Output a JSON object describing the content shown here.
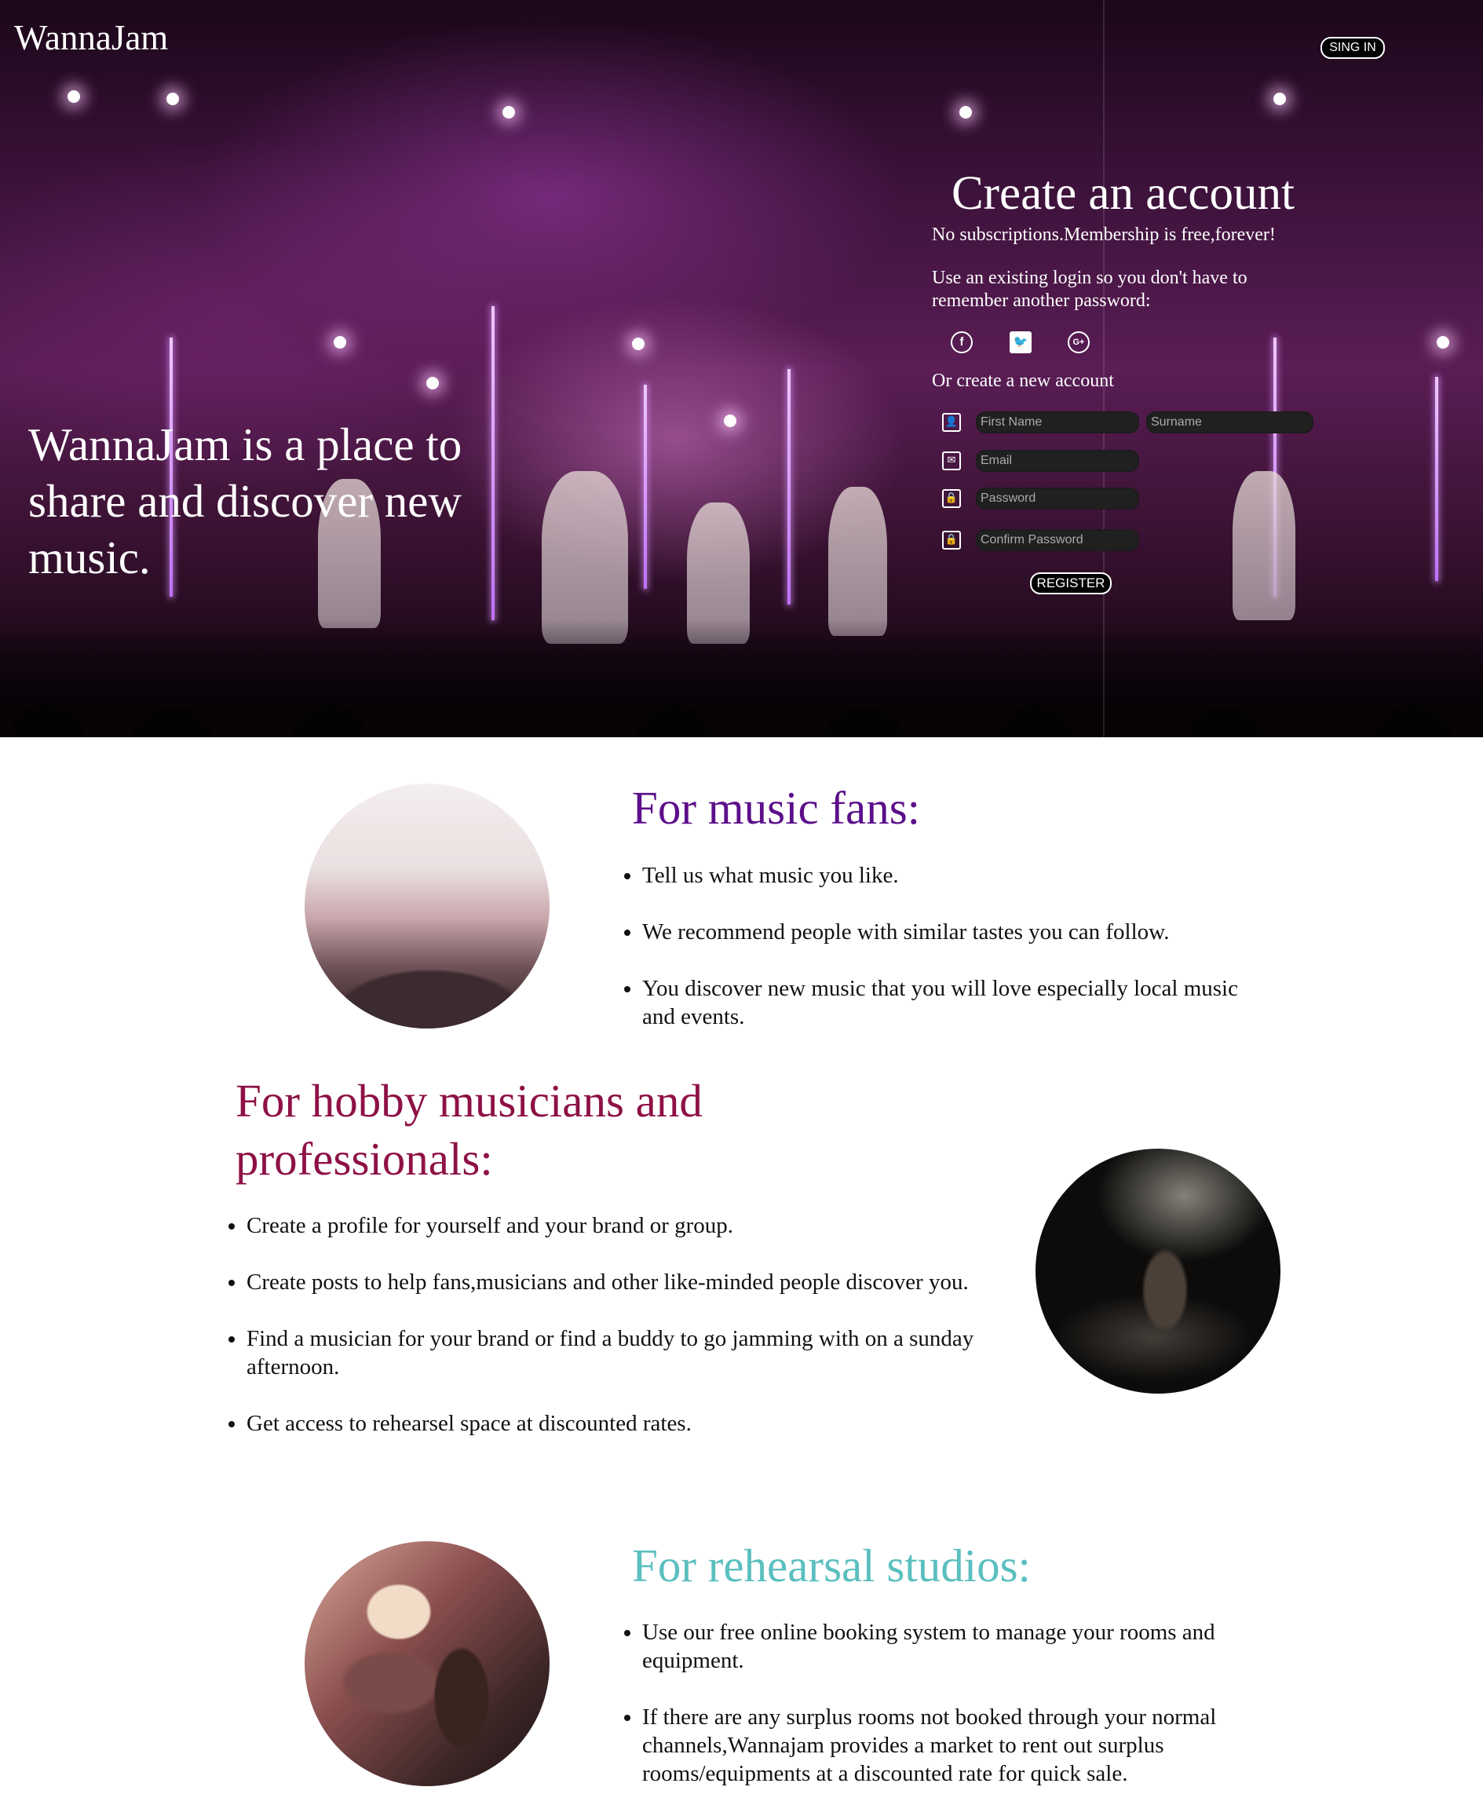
{
  "header": {
    "logo": "WannaJam",
    "signin_label": "SING IN"
  },
  "hero": {
    "tagline": "WannaJam is a place to share and discover new music."
  },
  "signup": {
    "title": "Create an account",
    "subtitle": "No subscriptions.Membership is free,forever!",
    "existing_login": "Use an existing login so you don't have to remember another password:",
    "social": [
      "facebook-icon",
      "twitter-icon",
      "google-plus-icon"
    ],
    "or_create": "Or create a new account",
    "first_name_placeholder": "First Name",
    "surname_placeholder": "Surname",
    "email_placeholder": "Email",
    "password_placeholder": "Password",
    "confirm_password_placeholder": "Confirm Password",
    "register_label": "REGISTER"
  },
  "sections": {
    "fans": {
      "title": "For music fans:",
      "color": "#5c0f8a",
      "items": [
        "Tell us what music you like.",
        "We recommend people with similar tastes you can follow.",
        "You discover new music that you will love especially local music and events."
      ]
    },
    "musicians": {
      "title": "For hobby musicians and professionals:",
      "color": "#8e1146",
      "items": [
        "Create a profile for yourself and your brand or group.",
        "Create posts to help fans,musicians and other like-minded people discover you.",
        "Find a musician for your brand or find a buddy to go jamming with on a sunday afternoon.",
        "Get access to rehearsel space at discounted rates."
      ]
    },
    "studios": {
      "title": "For rehearsal studios:",
      "color": "#5bbfbf",
      "items": [
        "Use our free online booking system to manage your rooms and equipment.",
        "If there are any surplus rooms not booked through your normal channels,Wannajam provides a market to rent out surplus rooms/equipments at a discounted rate for quick sale."
      ]
    }
  }
}
